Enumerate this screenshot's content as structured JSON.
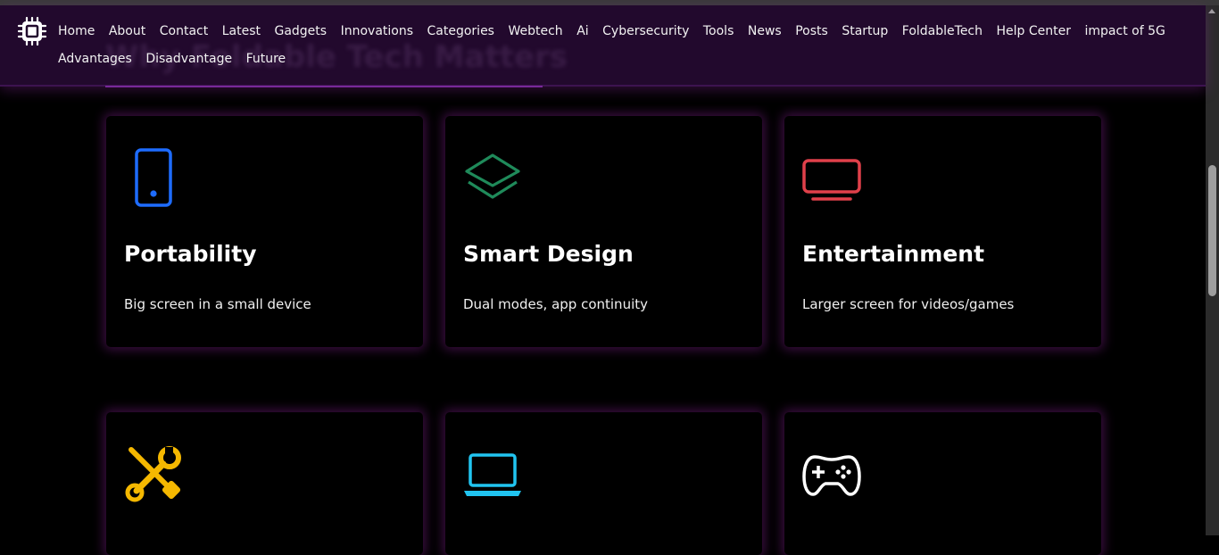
{
  "nav": {
    "logo_icon": "chip-icon",
    "row1": [
      "Home",
      "About",
      "Contact",
      "Latest",
      "Gadgets",
      "Innovations",
      "Categories",
      "Webtech",
      "Ai",
      "Cybersecurity",
      "Tools",
      "News",
      "Posts",
      "Startup",
      "FoldableTech",
      "Help Center",
      "impact of 5G"
    ],
    "row2": [
      "Advantages",
      "Disadvantage",
      "Future"
    ]
  },
  "cards": [
    {
      "icon": "phone-icon",
      "icon_color": "#1e6cff",
      "title": "Portability",
      "desc": "Big screen in a small device"
    },
    {
      "icon": "layers-icon",
      "icon_color": "#1f8a5a",
      "title": "Smart Design",
      "desc": "Dual modes, app continuity"
    },
    {
      "icon": "monitor-icon",
      "icon_color": "#e0404a",
      "title": "Entertainment",
      "desc": "Larger screen for videos/games"
    },
    {
      "icon": "tools-icon",
      "icon_color": "#f5b800",
      "title": "",
      "desc": ""
    },
    {
      "icon": "laptop-icon",
      "icon_color": "#21c4f0",
      "title": "",
      "desc": ""
    },
    {
      "icon": "gamepad-icon",
      "icon_color": "#ffffff",
      "title": "",
      "desc": ""
    }
  ],
  "colors": {
    "nav_bg": "#22092d",
    "page_bg": "#000000",
    "card_glow": "#6e1978"
  }
}
